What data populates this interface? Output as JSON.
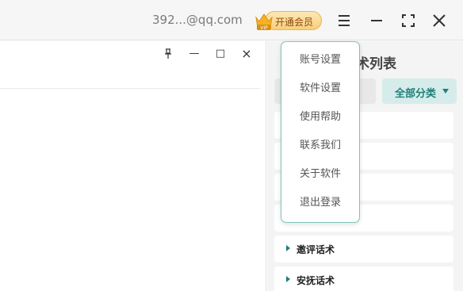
{
  "header": {
    "email": "392...@qq.com",
    "vip_label": "开通会员",
    "vip_badge": "VIP",
    "menu_icon": "hamburger-icon",
    "minimize_icon": "minimize-icon",
    "maximize_icon": "fullscreen-icon",
    "close_icon": "close-icon"
  },
  "left_panel": {
    "pin_icon": "pin-icon",
    "minimize_icon": "minimize-icon",
    "maximize_icon": "maximize-icon",
    "close_icon": "close-icon",
    "pin_glyph": "⊥",
    "min_glyph": "—",
    "max_glyph": "□",
    "close_glyph": "×"
  },
  "right_panel": {
    "title_partial": "术列表",
    "filter_label": "全部分类",
    "categories": [
      {
        "label": ""
      },
      {
        "label": ""
      },
      {
        "label": ""
      },
      {
        "label": ""
      },
      {
        "label": "邀评话术"
      },
      {
        "label": "安抚话术"
      }
    ]
  },
  "menu": {
    "items": [
      {
        "label": "账号设置"
      },
      {
        "label": "软件设置"
      },
      {
        "label": "使用帮助"
      },
      {
        "label": "联系我们"
      },
      {
        "label": "关于软件"
      },
      {
        "label": "退出登录"
      }
    ]
  },
  "colors": {
    "accent": "#1f7f7a",
    "vip_gold": "#f8cf7b",
    "menu_border": "#7fc3bd"
  }
}
